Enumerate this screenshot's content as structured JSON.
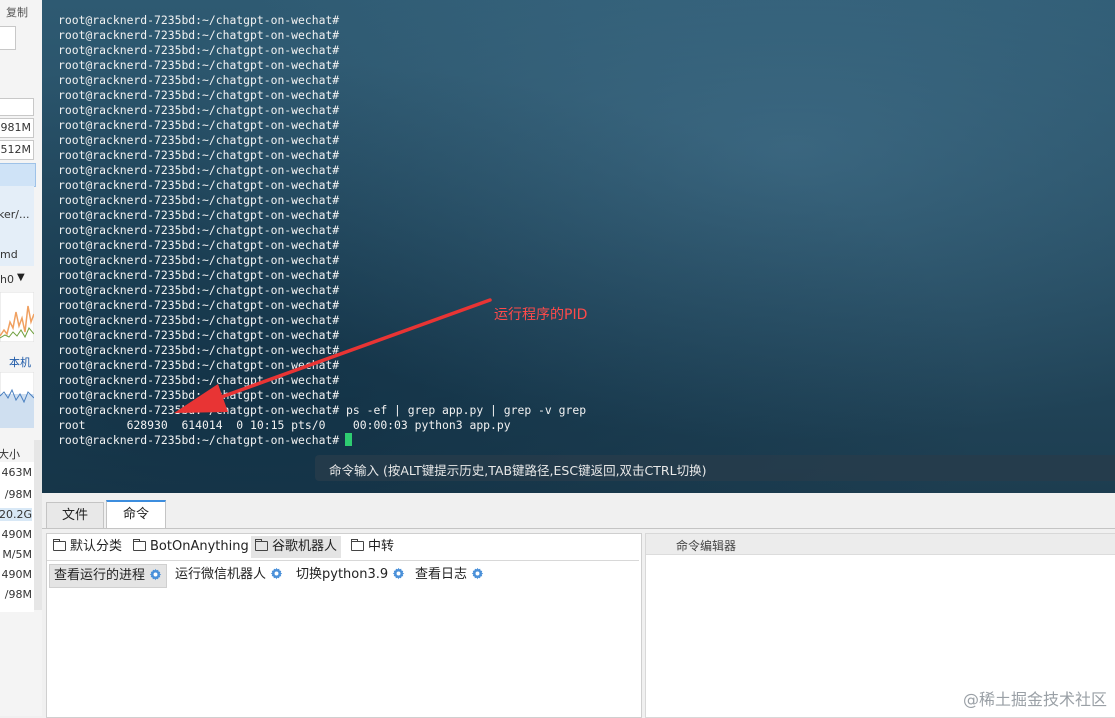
{
  "left_panel": {
    "copy_label": "复制",
    "mem_1": "981M",
    "mem_2": "512M",
    "path_fragment": "ker/...",
    "cmd_fragment": "md",
    "iface_fragment": "h0",
    "local_label": "本机",
    "size_header": "大小",
    "sizes": [
      "463M",
      "/98M",
      "20.2G",
      "490M",
      "M/5M",
      "490M",
      "/98M"
    ]
  },
  "terminal": {
    "prompt": "root@racknerd-7235bd:~/chatgpt-on-wechat#",
    "empty_prompt_count": 26,
    "command": "ps -ef | grep app.py | grep -v grep",
    "process_line": "root      628930  614014  0 10:15 pts/0    00:00:03 python3 app.py",
    "annotation": "运行程序的PID",
    "input_hint": "命令输入 (按ALT键提示历史,TAB键路径,ESC键返回,双击CTRL切换)",
    "cursor_color": "#2ecc71",
    "annotation_color": "#ff4a4a"
  },
  "tabs": [
    {
      "label": "文件",
      "active": false
    },
    {
      "label": "命令",
      "active": true
    }
  ],
  "groups": [
    {
      "label": "默认分类",
      "active": false
    },
    {
      "label": "BotOnAnything",
      "active": false
    },
    {
      "label": "谷歌机器人",
      "active": true
    },
    {
      "label": "中转",
      "active": false
    }
  ],
  "commands": [
    {
      "label": "查看运行的进程",
      "active": true
    },
    {
      "label": "运行微信机器人",
      "active": false
    },
    {
      "label": "切换python3.9",
      "active": false
    },
    {
      "label": "查看日志",
      "active": false
    }
  ],
  "editor": {
    "title": "命令编辑器"
  },
  "watermark": "@稀土掘金技术社区",
  "icons": {
    "folder": "folder-icon",
    "gear": "gear-icon"
  },
  "colors": {
    "accent": "#3c8dde",
    "gear": "#4a90d9"
  }
}
